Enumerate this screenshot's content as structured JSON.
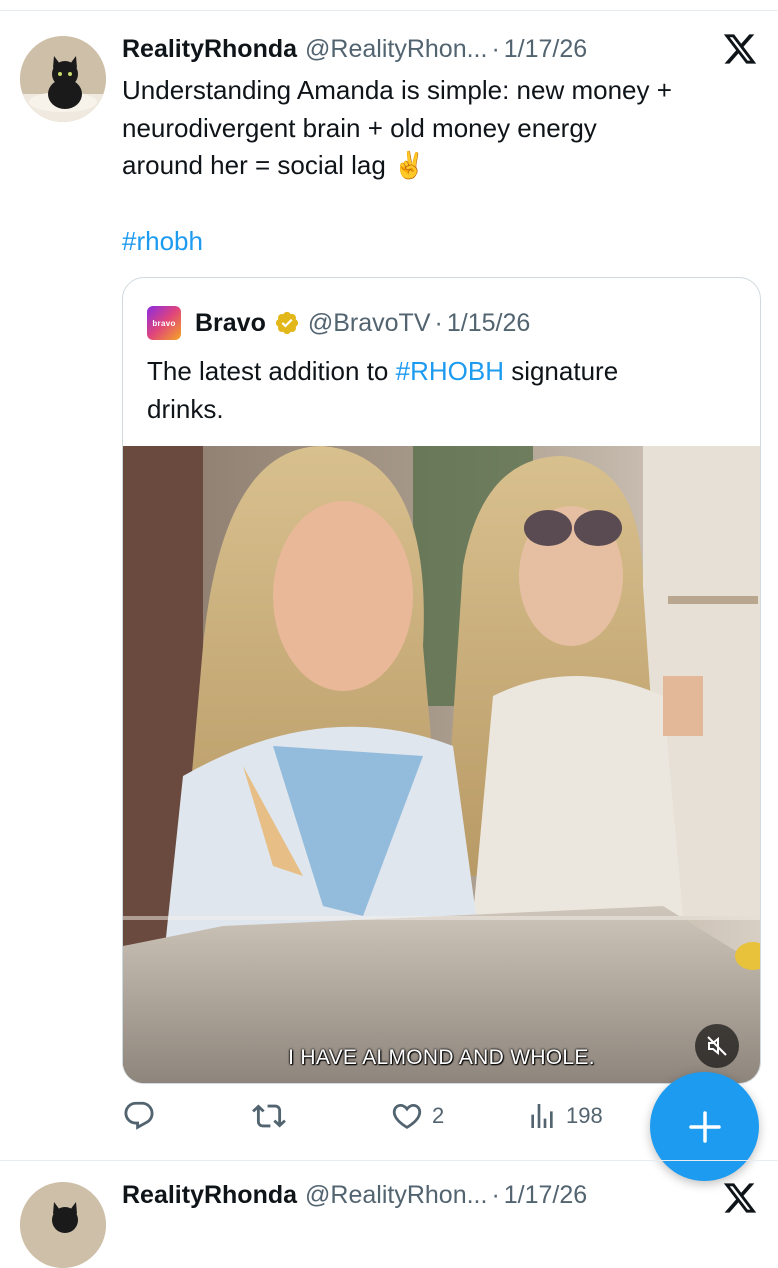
{
  "tweet": {
    "display_name": "RealityRhonda",
    "handle": "@RealityRhon...",
    "separator": "·",
    "date": "1/17/26",
    "text_lines": [
      "Understanding Amanda is simple: new money +",
      "neurodivergent brain + old money energy",
      "around her = social lag ✌️"
    ],
    "hashtag": "#rhobh"
  },
  "quoted": {
    "logo_text": "bravo",
    "display_name": "Bravo",
    "handle": "@BravoTV",
    "separator": "·",
    "date": "1/15/26",
    "text_before": "The latest addition to ",
    "hashtag": "#RHOBH",
    "text_after_line1": " signature",
    "text_line2": "drinks.",
    "video_caption": "I HAVE ALMOND AND WHOLE."
  },
  "actions": {
    "reply_count": "",
    "retweet_count": "",
    "like_count": "2",
    "views_count": "198"
  },
  "next_tweet": {
    "display_name": "RealityRhonda",
    "handle": "@RealityRhon...",
    "separator": "·",
    "date": "1/17/26"
  },
  "icons": {
    "platform_logo": "x-logo-icon",
    "verified": "verified-gold-badge-icon",
    "reply": "reply-icon",
    "retweet": "retweet-icon",
    "like": "heart-icon",
    "views": "views-icon",
    "mute": "mute-icon",
    "compose": "plus-icon"
  },
  "colors": {
    "accent": "#1d9bf0",
    "text_primary": "#0f1419",
    "text_secondary": "#536471",
    "verified_gold": "#e2b719"
  }
}
